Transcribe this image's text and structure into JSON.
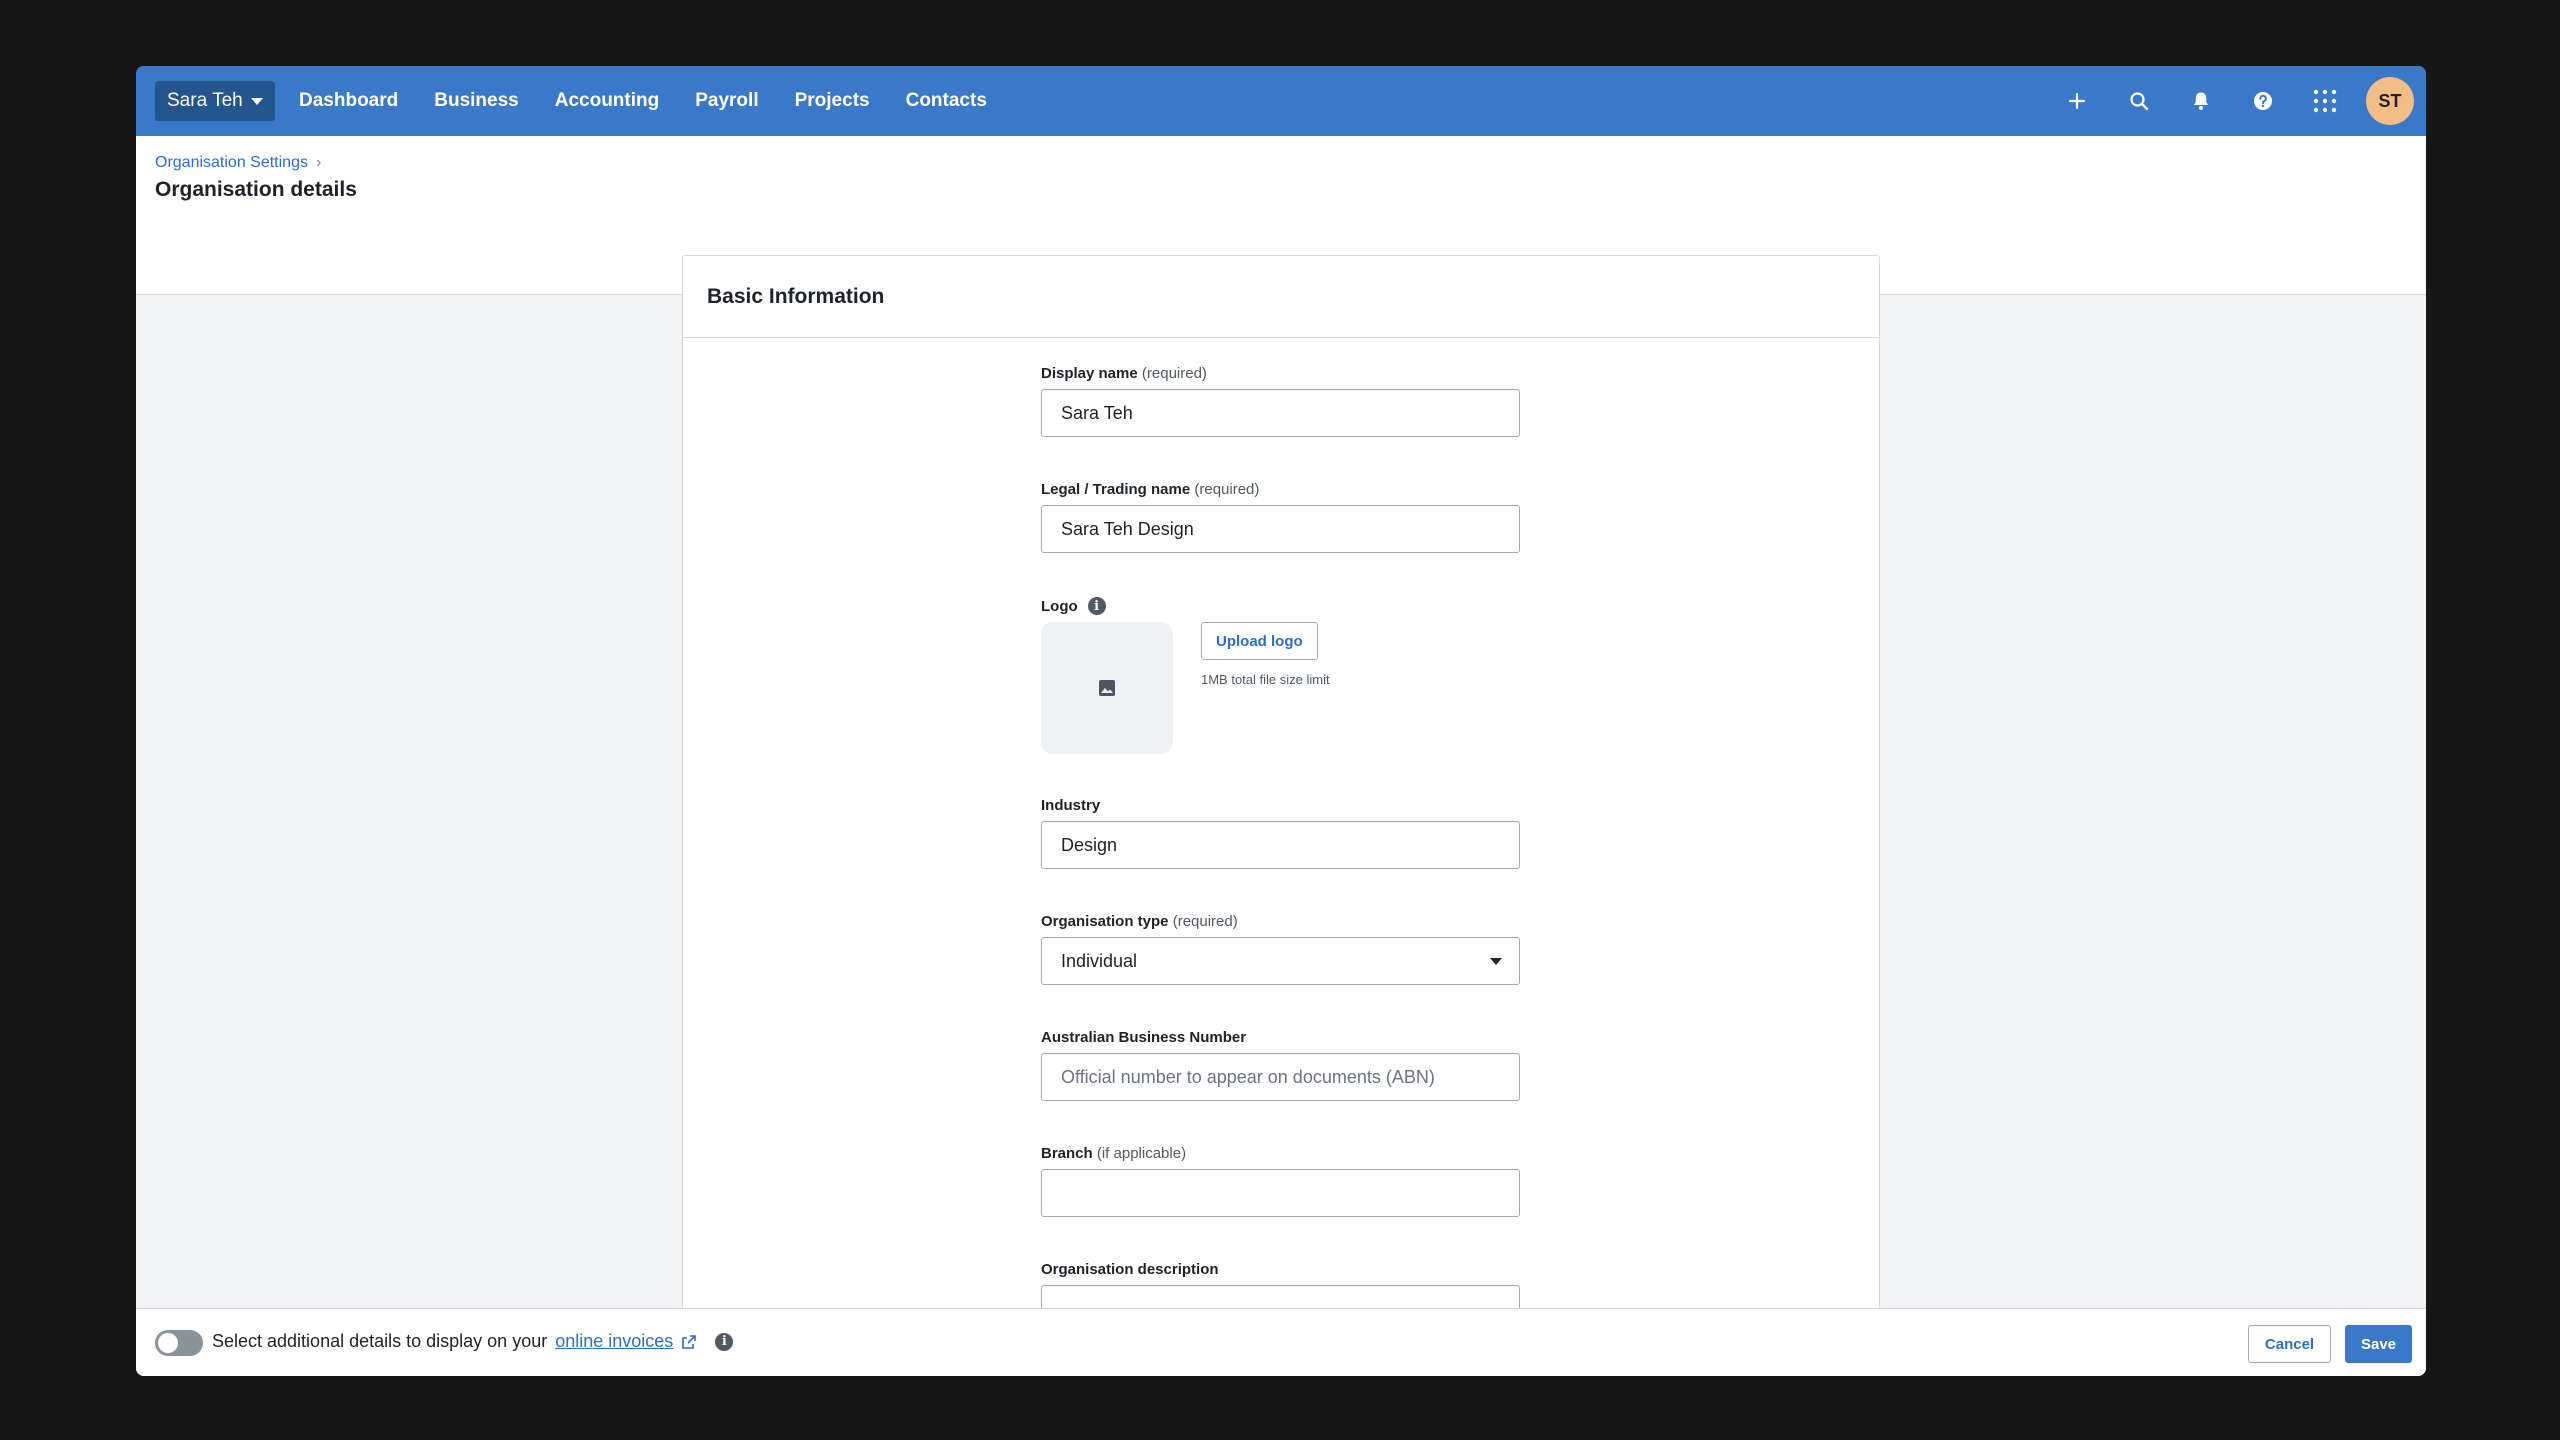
{
  "nav": {
    "org_name": "Sara Teh",
    "links": [
      "Dashboard",
      "Business",
      "Accounting",
      "Payroll",
      "Projects",
      "Contacts"
    ],
    "icons": [
      "plus-icon",
      "search-icon",
      "bell-icon",
      "help-icon",
      "apps-grid-icon"
    ],
    "avatar_initials": "ST",
    "brand_color": "#3a78c8"
  },
  "page": {
    "breadcrumb": "Organisation Settings",
    "title": "Organisation details"
  },
  "card": {
    "title": "Basic Information",
    "fields": {
      "display_name": {
        "label": "Display name",
        "qualifier": "(required)",
        "value": "Sara Teh"
      },
      "legal_name": {
        "label": "Legal / Trading name",
        "qualifier": "(required)",
        "value": "Sara Teh Design"
      },
      "logo": {
        "label": "Logo",
        "upload_label": "Upload logo",
        "note": "1MB total file size limit"
      },
      "industry": {
        "label": "Industry",
        "value": "Design"
      },
      "org_type": {
        "label": "Organisation type",
        "qualifier": "(required)",
        "value": "Individual"
      },
      "abn": {
        "label": "Australian Business Number",
        "placeholder": "Official number to appear on documents (ABN)"
      },
      "branch": {
        "label": "Branch",
        "qualifier": "(if applicable)",
        "value": ""
      },
      "description": {
        "label": "Organisation description"
      }
    }
  },
  "footer": {
    "toggle_on": false,
    "text": "Select additional details to display on your",
    "link": "online invoices",
    "cancel_label": "Cancel",
    "save_label": "Save"
  }
}
